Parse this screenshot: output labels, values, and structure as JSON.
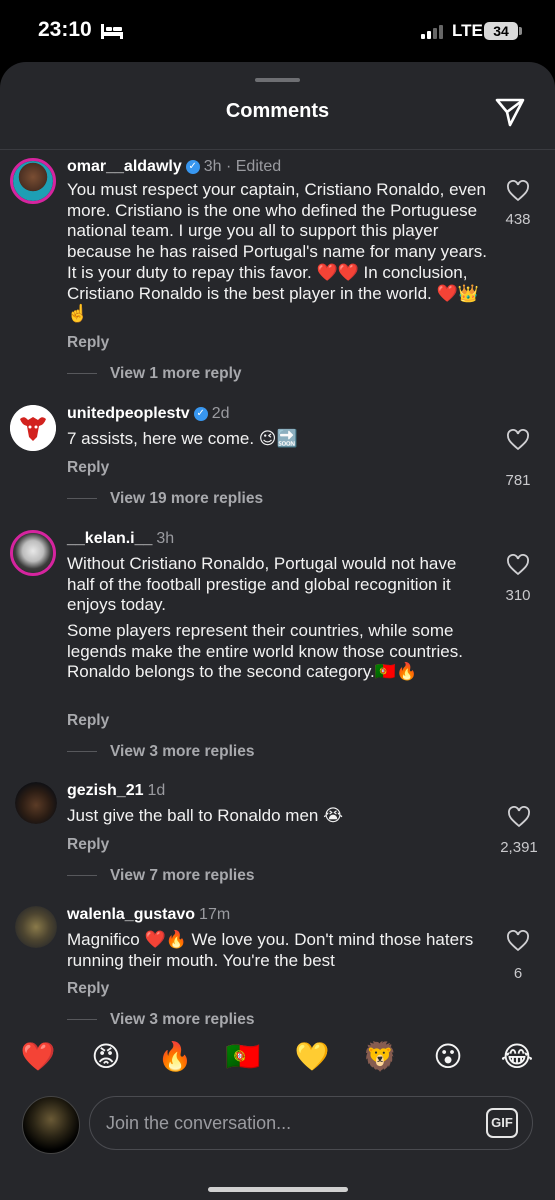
{
  "status_bar": {
    "time": "23:10",
    "network": "LTE",
    "battery": "34"
  },
  "sheet": {
    "title": "Comments"
  },
  "comments": [
    {
      "username": "omar__aldawly",
      "verified": true,
      "meta": "3h · Edited",
      "text": "You must respect your captain, Cristiano Ronaldo, even more. Cristiano is the one who defined the Portuguese national team. I urge you all to support this player because he has raised Portugal's name for many years. It is your duty to repay this favor. ❤️❤️ In conclusion, Cristiano Ronaldo is the best player in the world. ❤️👑☝️",
      "reply_label": "Reply",
      "view_more": "View 1 more reply",
      "likes": "438"
    },
    {
      "username": "unitedpeoplestv",
      "verified": true,
      "meta": "2d",
      "text": "7 assists, here we come. 😉🔜",
      "reply_label": "Reply",
      "view_more": "View 19 more replies",
      "likes": "781"
    },
    {
      "username": "__kelan.i__",
      "verified": false,
      "meta": "3h",
      "text": "Without Cristiano Ronaldo, Portugal would not have half of the football prestige and global recognition it enjoys today.",
      "text2": "Some players represent their countries, while some legends make the entire world know those countries. Ronaldo belongs to the second category.🇵🇹🔥",
      "reply_label": "Reply",
      "view_more": "View 3 more replies",
      "likes": "310"
    },
    {
      "username": "gezish_21",
      "verified": false,
      "meta": "1d",
      "text": "Just give the ball to Ronaldo men 😭",
      "reply_label": "Reply",
      "view_more": "View 7 more replies",
      "likes": "2,391"
    },
    {
      "username": "walenla_gustavo",
      "verified": false,
      "meta": "17m",
      "text": "Magnifico ❤️🔥 We love you. Don't mind those haters running their mouth. You're the best",
      "reply_label": "Reply",
      "view_more": "View 3 more replies",
      "likes": "6"
    }
  ],
  "reactions": [
    "❤️",
    "😡",
    "🔥",
    "🇵🇹",
    "💛",
    "🦁",
    "😮",
    "😂"
  ],
  "composer": {
    "placeholder": "Join the conversation...",
    "gif_label": "GIF"
  }
}
